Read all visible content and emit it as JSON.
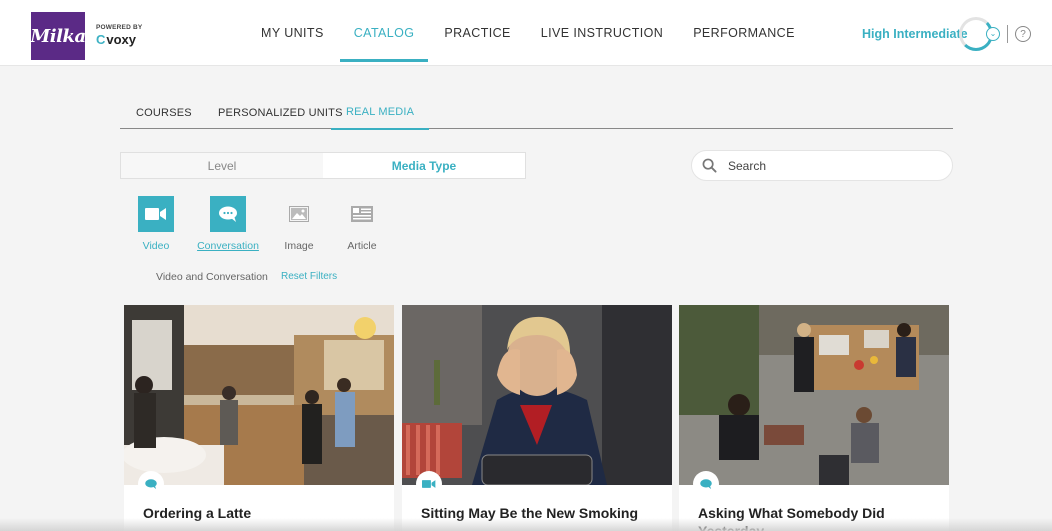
{
  "brand": {
    "logo_text": "Milka",
    "powered_by": "POWERED BY",
    "product": "voxy",
    "product_mark": "C"
  },
  "nav": {
    "items": [
      {
        "label": "MY UNITS",
        "active": false
      },
      {
        "label": "CATALOG",
        "active": true
      },
      {
        "label": "PRACTICE",
        "active": false
      },
      {
        "label": "LIVE INSTRUCTION",
        "active": false
      },
      {
        "label": "PERFORMANCE",
        "active": false
      }
    ]
  },
  "header": {
    "level": "High Intermediate",
    "help": "?"
  },
  "subtabs": [
    {
      "label": "COURSES",
      "active": false
    },
    {
      "label": "PERSONALIZED UNITS",
      "active": false
    },
    {
      "label": "REAL MEDIA",
      "active": true
    }
  ],
  "filter_toggle": {
    "level": "Level",
    "media_type": "Media Type",
    "selected": "Media Type"
  },
  "search": {
    "placeholder": "Search",
    "value": ""
  },
  "media_types": [
    {
      "label": "Video",
      "icon": "video-camera-icon",
      "selected": true
    },
    {
      "label": "Conversation",
      "icon": "speech-bubbles-icon",
      "selected": true
    },
    {
      "label": "Image",
      "icon": "image-icon",
      "selected": false
    },
    {
      "label": "Article",
      "icon": "article-icon",
      "selected": false
    }
  ],
  "filter_summary": "Video and Conversation",
  "reset_label": "Reset Filters",
  "cards": [
    {
      "title": "Ordering a Latte",
      "type_icon": "speech-bubbles-icon"
    },
    {
      "title": "Sitting May Be the New Smoking",
      "type_icon": "video-camera-icon"
    },
    {
      "title": "Asking What Somebody Did Yesterday",
      "type_icon": "speech-bubbles-icon"
    }
  ],
  "colors": {
    "accent": "#3ab0c2",
    "brand": "#5b2a86"
  }
}
